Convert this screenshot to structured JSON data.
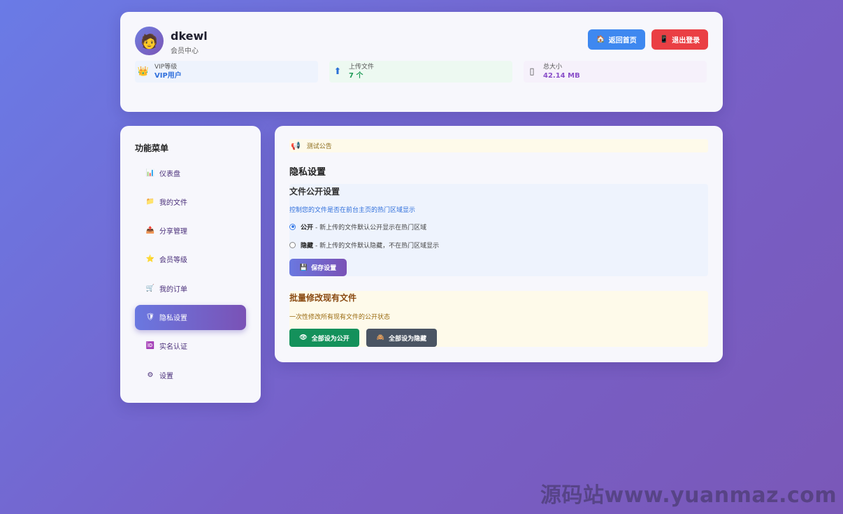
{
  "user": {
    "avatar_icon": "🧑",
    "name": "dkewl",
    "subtitle": "会员中心"
  },
  "header": {
    "home_icon": "🏠",
    "home_label": "返回首页",
    "logout_icon": "📱",
    "logout_label": "退出登录"
  },
  "stats": {
    "vip": {
      "icon": "👑",
      "label": "VIP等级",
      "value": "VIP用户"
    },
    "upload": {
      "icon": "⬆",
      "label": "上传文件",
      "value": "7 个"
    },
    "size": {
      "icon": "▯",
      "label": "总大小",
      "value": "42.14 MB"
    }
  },
  "sidebar": {
    "title": "功能菜单",
    "items": [
      {
        "icon": "📊",
        "label": "仪表盘",
        "active": false
      },
      {
        "icon": "📁",
        "label": "我的文件",
        "active": false
      },
      {
        "icon": "📤",
        "label": "分享管理",
        "active": false
      },
      {
        "icon": "⭐",
        "label": "会员等级",
        "active": false
      },
      {
        "icon": "🛒",
        "label": "我的订单",
        "active": false
      },
      {
        "icon": "🛡",
        "label": "隐私设置",
        "active": true
      },
      {
        "icon": "🆔",
        "label": "实名认证",
        "active": false
      },
      {
        "icon": "⚙",
        "label": "设置",
        "active": false
      }
    ]
  },
  "main": {
    "notice_icon": "📢",
    "notice": "测试公告",
    "title": "隐私设置",
    "visibility": {
      "title": "文件公开设置",
      "description": "控制您的文件是否在前台主页的热门区域显示",
      "options": [
        {
          "label": "公开",
          "desc": " - 新上传的文件默认公开显示在热门区域",
          "checked": true
        },
        {
          "label": "隐藏",
          "desc": " - 新上传的文件默认隐藏，不在热门区域显示",
          "checked": false
        }
      ],
      "save_icon": "💾",
      "save_label": "保存设置"
    },
    "bulk": {
      "title": "批量修改现有文件",
      "description": "一次性修改所有现有文件的公开状态",
      "public_icon": "👁",
      "public_label": "全部设为公开",
      "hide_icon": "🙈",
      "hide_label": "全部设为隐藏"
    }
  },
  "watermark": "源码站www.yuanmaz.com"
}
